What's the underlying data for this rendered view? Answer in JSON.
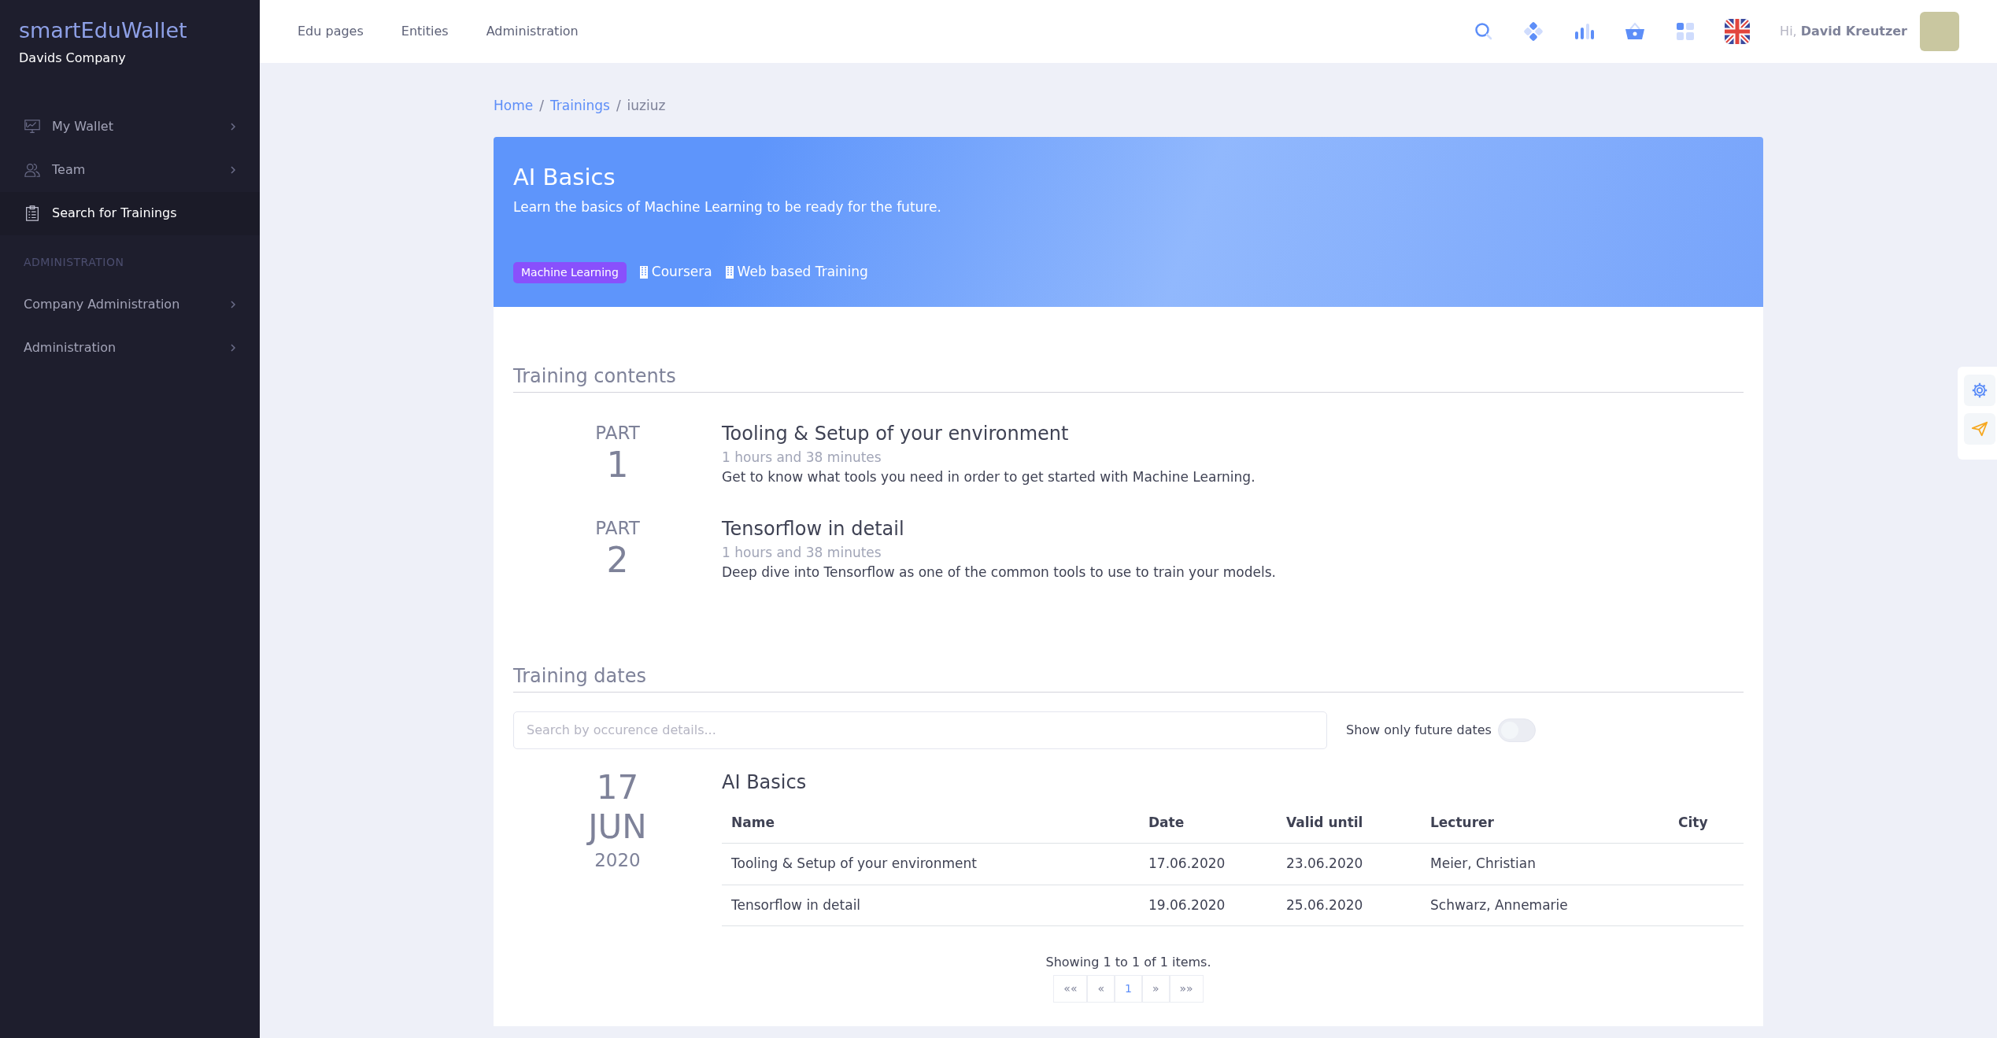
{
  "sidebar": {
    "brand": "smartEduWallet",
    "company": "Davids Company",
    "items": [
      {
        "label": "My Wallet",
        "has_submenu": true,
        "selected": false
      },
      {
        "label": "Team",
        "has_submenu": true,
        "selected": false
      },
      {
        "label": "Search for Trainings",
        "has_submenu": false,
        "selected": true
      }
    ],
    "section_title": "ADMINISTRATION",
    "admin_items": [
      {
        "label": "Company Administration",
        "has_submenu": true,
        "selected": false
      },
      {
        "label": "Administration",
        "has_submenu": true,
        "selected": false
      }
    ]
  },
  "topbar": {
    "links": [
      "Edu pages",
      "Entities",
      "Administration"
    ],
    "greeting": "Hi,",
    "user_name": "David Kreutzer"
  },
  "breadcrumb": {
    "separator": "/",
    "items": [
      {
        "label": "Home",
        "link": true
      },
      {
        "label": "Trainings",
        "link": true
      },
      {
        "label": "iuziuz",
        "link": false
      }
    ]
  },
  "training": {
    "title": "AI Basics",
    "description": "Learn the basics of Machine Learning to be ready for the future.",
    "tags": [
      {
        "label": "Machine Learning",
        "kind": "badge"
      },
      {
        "label": "Coursera",
        "kind": "building"
      },
      {
        "label": "Web based Training",
        "kind": "building"
      }
    ]
  },
  "contents": {
    "heading": "Training contents",
    "parts": [
      {
        "part_label": "PART",
        "number": "1",
        "title": "Tooling & Setup of your environment",
        "duration": "1 hours and 38 minutes",
        "description": "Get to know what tools you need in order to get started with Machine Learning."
      },
      {
        "part_label": "PART",
        "number": "2",
        "title": "Tensorflow in detail",
        "duration": "1 hours and 38 minutes",
        "description": "Deep dive into Tensorflow as one of the common tools to use to train your models."
      }
    ]
  },
  "dates": {
    "heading": "Training dates",
    "search": {
      "placeholder": "Search by occurence details..."
    },
    "future_toggle": {
      "label": "Show only future dates",
      "on": false
    },
    "occurrences": [
      {
        "day": "17",
        "month": "JUN",
        "year": "2020",
        "title": "AI Basics",
        "table": {
          "columns": [
            "Name",
            "Date",
            "Valid until",
            "Lecturer",
            "City"
          ],
          "rows": [
            [
              "Tooling & Setup of your environment",
              "17.06.2020",
              "23.06.2020",
              "Meier, Christian"
            ],
            [
              "Tensorflow in detail",
              "19.06.2020",
              "25.06.2020",
              "Schwarz, Annemarie"
            ]
          ]
        }
      }
    ],
    "summary": "Showing 1 to 1 of 1 items.",
    "pagination": [
      {
        "label": "««",
        "selected": false
      },
      {
        "label": "«",
        "selected": false
      },
      {
        "label": "1",
        "selected": true
      },
      {
        "label": "»",
        "selected": false
      },
      {
        "label": "»»",
        "selected": false
      }
    ]
  }
}
